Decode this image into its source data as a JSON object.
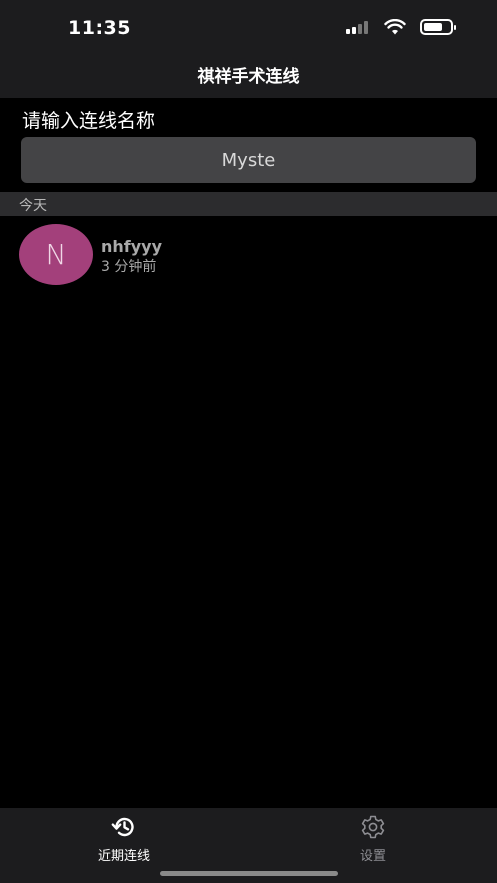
{
  "status_bar": {
    "time": "11:35",
    "battery_level": 0.7
  },
  "nav": {
    "title": "祺祥手术连线"
  },
  "form": {
    "prompt": "请输入连线名称",
    "input_value": "Myste"
  },
  "section": {
    "header": "今天"
  },
  "sessions": [
    {
      "avatar_letter": "N",
      "avatar_color": "#a3407b",
      "name": "nhfyyy",
      "time": "3 分钟前"
    }
  ],
  "tabs": [
    {
      "label": "近期连线",
      "icon": "history-icon",
      "active": true
    },
    {
      "label": "设置",
      "icon": "gear-icon",
      "active": false
    }
  ]
}
